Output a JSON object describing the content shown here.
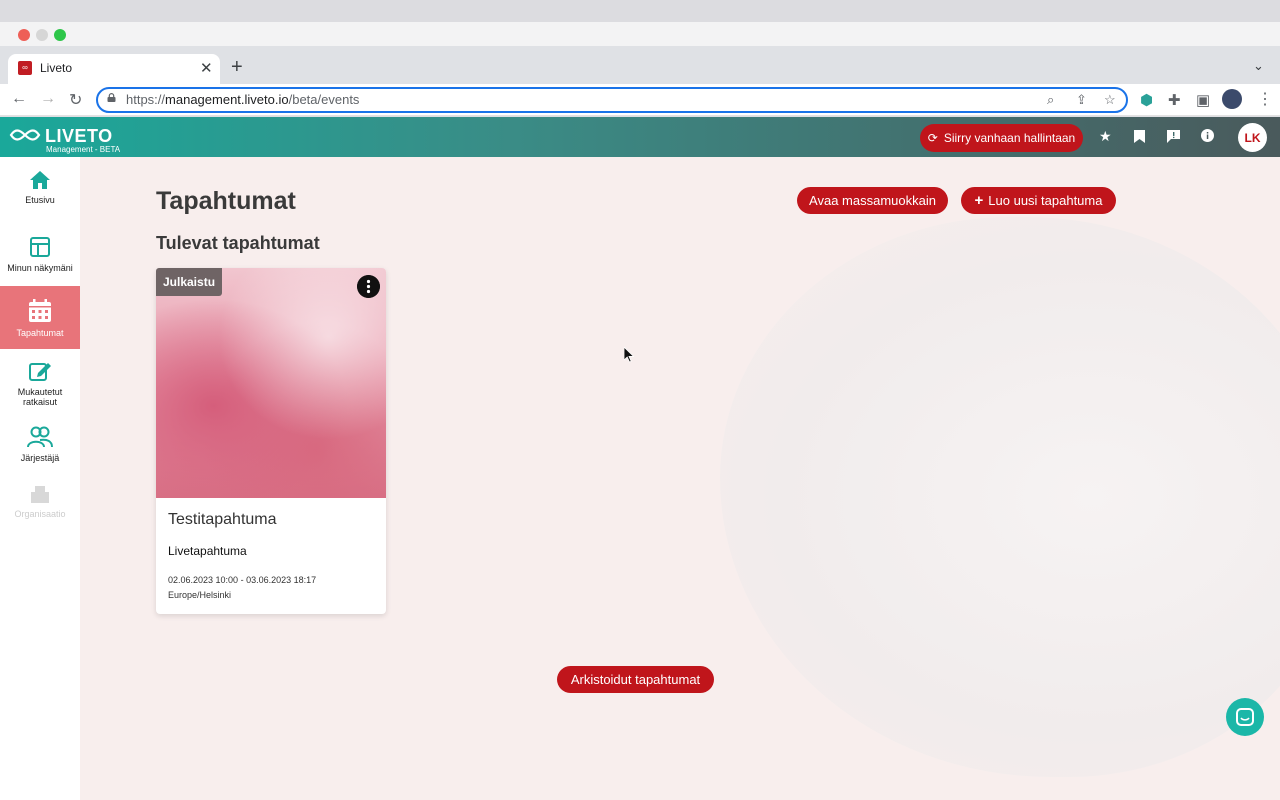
{
  "browser": {
    "tab_title": "Liveto",
    "favicon_text": "∞",
    "url_scheme": "https://",
    "url_host": "management.liveto.io",
    "url_path": "/beta/events"
  },
  "app": {
    "logo_text": "LIVETO",
    "logo_sub": "Management - BETA",
    "legacy_button": "Siirry vanhaan hallintaan",
    "avatar_initials": "LK",
    "brand_color": "#c0151b",
    "accent_color": "#1aa89a"
  },
  "sidebar": {
    "items": [
      {
        "label": "Etusivu",
        "icon": "home-icon"
      },
      {
        "label": "Minun näkymäni",
        "icon": "layout-icon"
      },
      {
        "label": "Tapahtumat",
        "icon": "calendar-icon"
      },
      {
        "label": "Mukautetut ratkaisut",
        "icon": "edit-icon"
      },
      {
        "label": "Järjestäjä",
        "icon": "users-icon"
      },
      {
        "label": "Organisaatio",
        "icon": "building-icon"
      }
    ]
  },
  "main": {
    "title": "Tapahtumat",
    "bulk_edit_button": "Avaa massamuokkain",
    "new_event_button": "Luo uusi tapahtuma",
    "upcoming_title": "Tulevat tapahtumat",
    "archived_button": "Arkistoidut tapahtumat"
  },
  "event": {
    "status": "Julkaistu",
    "name": "Testitapahtuma",
    "type": "Livetapahtuma",
    "dates": "02.06.2023 10:00 - 03.06.2023 18:17",
    "timezone": "Europe/Helsinki"
  }
}
